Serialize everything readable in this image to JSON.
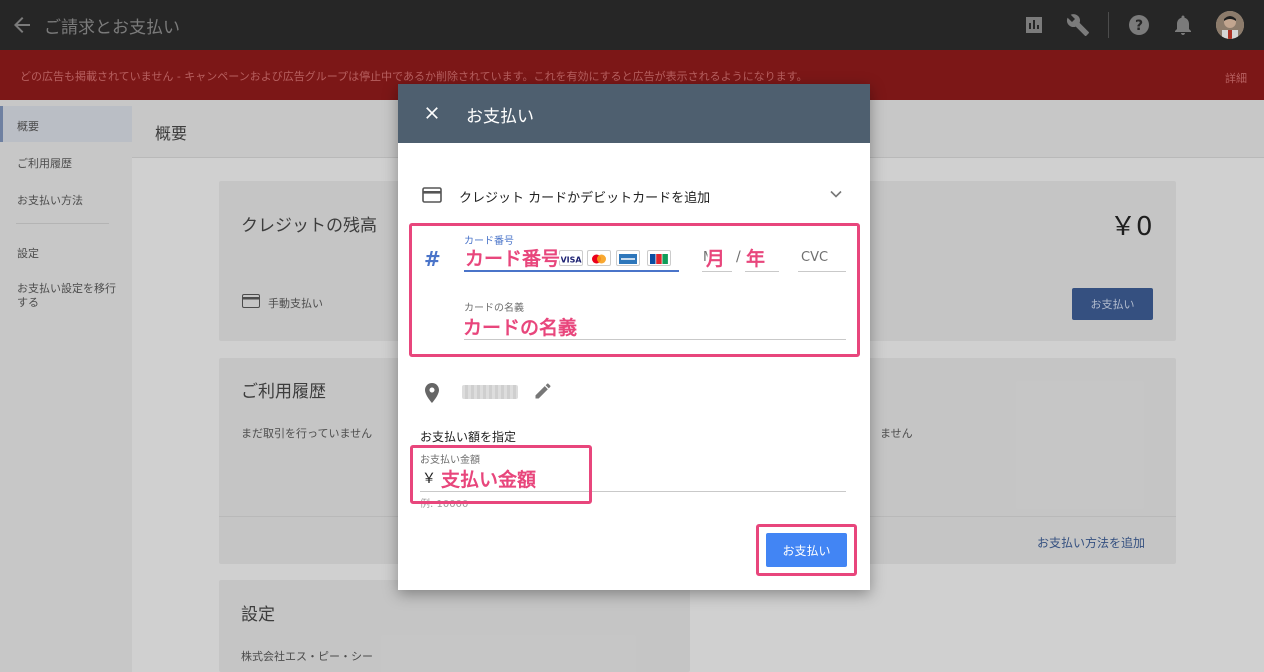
{
  "header": {
    "title": "ご請求とお支払い",
    "icons": [
      "back-arrow-icon",
      "reports-icon",
      "tools-icon",
      "help-icon",
      "notification-bell-icon",
      "avatar"
    ]
  },
  "alert": {
    "message": "どの広告も掲載されていません - キャンペーンおよび広告グループは停止中であるか削除されています。これを有効にすると広告が表示されるようになります。",
    "link": "詳細"
  },
  "sidebar": {
    "items": [
      "概要",
      "ご利用履歴",
      "お支払い方法",
      "設定",
      "お支払い設定を移行する"
    ]
  },
  "content": {
    "title": "概要",
    "credit_card": {
      "title": "クレジットの残高",
      "amount": "￥0",
      "manual_payment": "手動支払い",
      "pay_button": "お支払い"
    },
    "history_card": {
      "title": "ご利用履歴",
      "empty_text": "まだ取引を行っていません"
    },
    "payment_methods_card": {
      "empty_text": "ません",
      "add_link": "お支払い方法を追加"
    },
    "settings_card": {
      "title": "設定",
      "company": "株式会社エス・ピー・シー"
    }
  },
  "dialog": {
    "title": "お支払い",
    "method_label": "クレジット カードかデビットカードを追加",
    "card_number_label": "カード番号",
    "card_number_annotation": "カード番号",
    "brands": [
      "VISA",
      "Mastercard",
      "American Express",
      "JCB"
    ],
    "month_annotation": "月",
    "month_placeholder": "M",
    "slash": "/",
    "year_annotation": "年",
    "cvc_placeholder": "CVC",
    "card_name_label": "カードの名義",
    "card_name_annotation": "カードの名義",
    "amount_section_title": "お支払い額を指定",
    "amount_label": "お支払い金額",
    "currency": "￥",
    "amount_annotation": "支払い金額",
    "amount_hint": "例: 10000",
    "pay_button": "お支払い"
  },
  "colors": {
    "accent": "#4285f4",
    "highlight": "#e8467c",
    "dialog_header": "#4e5f6f",
    "alert": "#8b1a1a"
  }
}
